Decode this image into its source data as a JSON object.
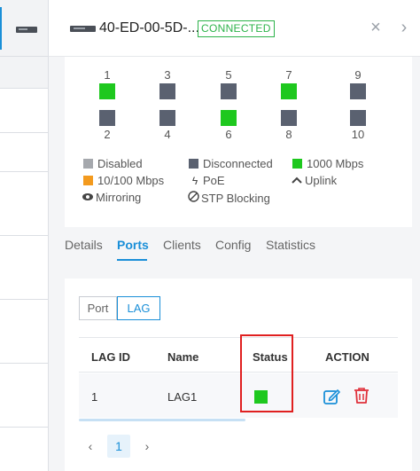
{
  "header": {
    "title": "40-ED-00-5D-...",
    "status_badge": "CONNECTED",
    "close_icon": "×",
    "next_icon": "›"
  },
  "ports": [
    {
      "number": "1",
      "status": "1000 Mbps"
    },
    {
      "number": "2",
      "status": "Disconnected"
    },
    {
      "number": "3",
      "status": "Disconnected"
    },
    {
      "number": "4",
      "status": "Disconnected"
    },
    {
      "number": "5",
      "status": "Disconnected"
    },
    {
      "number": "6",
      "status": "1000 Mbps"
    },
    {
      "number": "7",
      "status": "1000 Mbps"
    },
    {
      "number": "8",
      "status": "Disconnected"
    },
    {
      "number": "9",
      "status": "Disconnected"
    },
    {
      "number": "10",
      "status": "Disconnected"
    }
  ],
  "legend": {
    "disabled": "Disabled",
    "disconnected": "Disconnected",
    "gbps": "1000 Mbps",
    "mbps": "10/100 Mbps",
    "poe": "PoE",
    "uplink": "Uplink",
    "mirroring": "Mirroring",
    "stp": "STP Blocking"
  },
  "colors": {
    "disabled": "#a5a8ad",
    "disconnected": "#5a6170",
    "gbps": "#1ec81e",
    "mbps": "#f39a1e",
    "accent": "#1a8fd8",
    "connected": "#2db34a",
    "highlight": "#e02020"
  },
  "tabs": [
    "Details",
    "Ports",
    "Clients",
    "Config",
    "Statistics"
  ],
  "active_tab": "Ports",
  "segment": {
    "port": "Port",
    "lag": "LAG",
    "selected": "LAG"
  },
  "table": {
    "headers": {
      "lag_id": "LAG ID",
      "name": "Name",
      "status": "Status",
      "action": "ACTION"
    },
    "rows": [
      {
        "lag_id": "1",
        "name": "LAG1",
        "status": "green",
        "actions": [
          "edit-icon",
          "trash-icon"
        ]
      }
    ]
  },
  "pagination": {
    "prev": "‹",
    "current": "1",
    "next": "›"
  }
}
